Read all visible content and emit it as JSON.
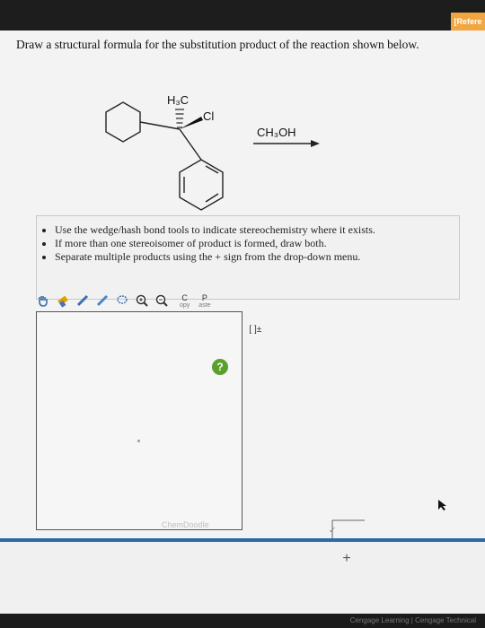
{
  "header": {
    "reference_tab": "[Refere"
  },
  "question": {
    "prompt": "Draw a structural formula for the substitution product of the reaction shown below.",
    "reagent": "CH₃OH",
    "labels": {
      "methyl": "H₃C",
      "chloro": "Cl"
    }
  },
  "instructions": [
    "Use the wedge/hash bond tools to indicate stereochemistry where it exists.",
    "If more than one stereoisomer of product is formed, draw both.",
    "Separate multiple products using the + sign from the drop-down menu."
  ],
  "toolbar": {
    "copy_label": "C",
    "copy_small": "opy",
    "paste_label": "P",
    "paste_small": "aste",
    "bracket_label": "[ ]±"
  },
  "editor": {
    "help_label": "?",
    "brand": "ChemDoodle"
  },
  "bottom": {
    "plus_label": "+",
    "check_label": "✓"
  },
  "footer": {
    "text": "Cengage Learning | Cengage Technical"
  },
  "colors": {
    "top_bar": "#1d1d1d",
    "accent_orange": "#f2a640",
    "blue_rule": "#2d6aa3",
    "help_green": "#5aa02c"
  },
  "icons": [
    "hand-icon",
    "eraser-icon",
    "pencil-icon",
    "lasso-icon",
    "zoom-in-icon",
    "zoom-out-icon",
    "single-bond-icon",
    "hash-bond-icon",
    "wedge-bond-icon",
    "double-bond-icon",
    "triple-bond-icon",
    "ring-icon",
    "help-icon"
  ]
}
